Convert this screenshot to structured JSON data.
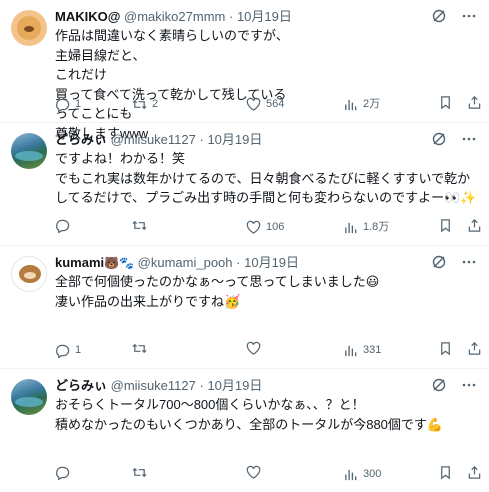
{
  "tweets": [
    {
      "display_name": "MAKIKO@",
      "handle": "@makiko27mmm",
      "date": "10月19日",
      "avatar": "bear-avatar",
      "body": "作品は間違いなく素晴らしいのですが、\n主婦目線だと、\nこれだけ\n買って食べて洗って乾かして残している\nってことにも\n尊敬しますwww",
      "replies": "1",
      "retweets": "2",
      "likes": "564",
      "views": "2万"
    },
    {
      "display_name": "どらみぃ",
      "handle": "@miisuke1127",
      "date": "10月19日",
      "avatar": "lake-avatar",
      "body": "ですよね！わかる！笑\nでもこれ実は数年かけてるので、日々朝食べるたびに軽くすすいで乾かしてるだけで、プラごみ出す時の手間と何も変わらないのですよー👀✨",
      "replies": "",
      "retweets": "",
      "likes": "106",
      "views": "1.8万"
    },
    {
      "display_name": "kumami",
      "name_emoji": "🐻🐾",
      "handle": "@kumami_pooh",
      "date": "10月19日",
      "avatar": "kuma-avatar",
      "body": "全部で何個使ったのかなぁ〜って思ってしまいました😃\n凄い作品の出来上がりですね🥳",
      "replies": "1",
      "retweets": "",
      "likes": "",
      "views": "331"
    },
    {
      "display_name": "どらみぃ",
      "handle": "@miisuke1127",
      "date": "10月19日",
      "avatar": "lake-avatar",
      "body": "おそらくトータル700〜800個くらいかなぁ、、？と！\n積めなかったのもいくつかあり、全部のトータルが今880個です💪",
      "replies": "",
      "retweets": "",
      "likes": "",
      "views": "300"
    }
  ]
}
